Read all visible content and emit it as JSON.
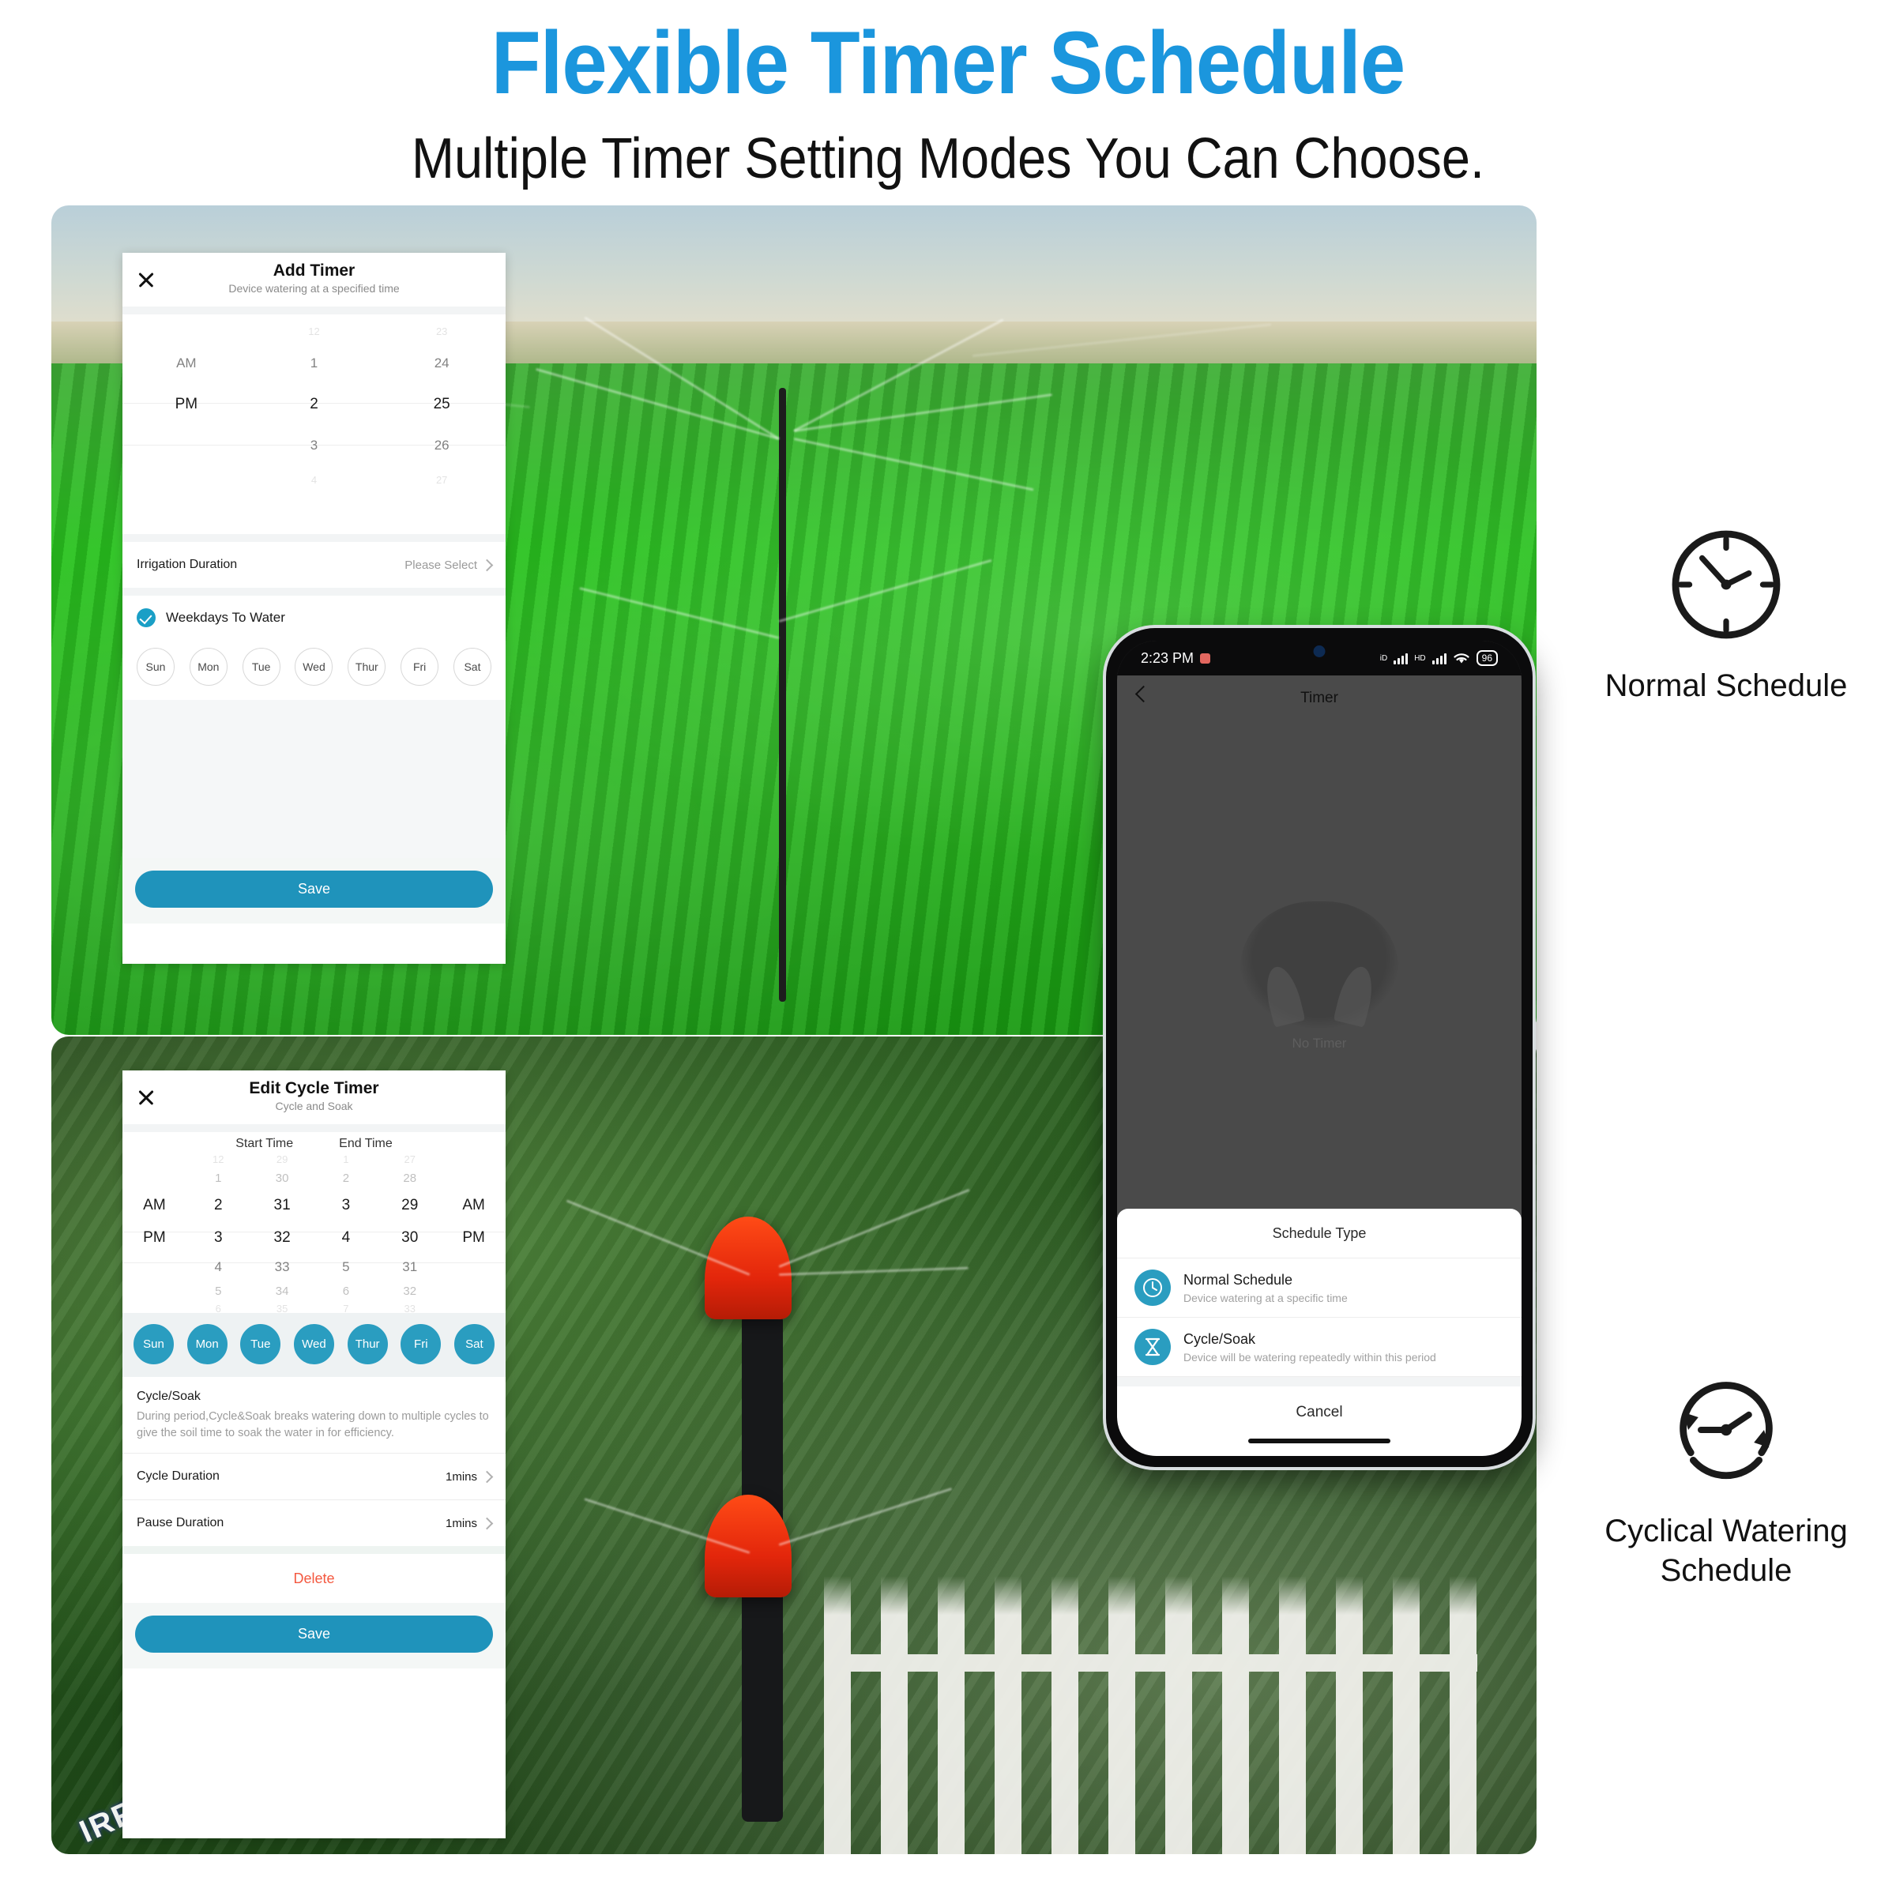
{
  "headline": {
    "title": "Flexible Timer Schedule",
    "subtitle": "Multiple Timer Setting Modes You Can Choose."
  },
  "colors": {
    "headline_blue": "#1b96dd",
    "accent_teal": "#1f93bb",
    "chip_teal": "#2a9dc0",
    "delete_red": "#f4583f"
  },
  "photo_top": {
    "watermark": ""
  },
  "photo_bottom": {
    "watermark": "IRRIGA"
  },
  "add_timer_card": {
    "close_icon": "close-icon",
    "title": "Add Timer",
    "subtitle": "Device watering at a specified time",
    "picker": {
      "meridiem": {
        "above": "",
        "selected": "PM",
        "above1": "AM",
        "below1": ""
      },
      "hours": {
        "above2": "12",
        "above1": "1",
        "selected": "2",
        "below1": "3",
        "below2": "4"
      },
      "minutes": {
        "above2": "23",
        "above1": "24",
        "selected": "25",
        "below1": "26",
        "below2": "27"
      }
    },
    "duration_row": {
      "label": "Irrigation Duration",
      "value": "Please Select",
      "chevron": "chevron-right-icon"
    },
    "weekdays_checkbox": {
      "label": "Weekdays To Water",
      "checked": true,
      "icon": "check-circle-icon"
    },
    "days": [
      "Sun",
      "Mon",
      "Tue",
      "Wed",
      "Thur",
      "Fri",
      "Sat"
    ],
    "save_label": "Save"
  },
  "cycle_timer_card": {
    "close_icon": "close-icon",
    "title": "Edit Cycle Timer",
    "subtitle": "Cycle and Soak",
    "column_headers": {
      "start": "Start Time",
      "end": "End Time"
    },
    "start_picker": {
      "meridiem": {
        "selected": "PM",
        "above1": "AM"
      },
      "hours": {
        "above2": "12",
        "above1": "1",
        "selected": "2",
        "sel2": "3",
        "below1": "4",
        "below2": "5",
        "below3": "6"
      },
      "minutes": {
        "above2": "29",
        "above1": "30",
        "selected": "31",
        "sel2": "32",
        "below1": "33",
        "below2": "34",
        "below3": "35"
      }
    },
    "end_picker": {
      "meridiem": {
        "selected": "PM",
        "above1": "AM"
      },
      "hours": {
        "above2": "1",
        "above1": "2",
        "selected": "3",
        "sel2": "4",
        "below1": "5",
        "below2": "6",
        "below3": "7"
      },
      "minutes": {
        "above2": "27",
        "above1": "28",
        "selected": "29",
        "sel2": "30",
        "below1": "31",
        "below2": "32",
        "below3": "33"
      }
    },
    "days": [
      "Sun",
      "Mon",
      "Tue",
      "Wed",
      "Thur",
      "Fri",
      "Sat"
    ],
    "section": {
      "title": "Cycle/Soak",
      "body": "During period,Cycle&Soak breaks watering down to multiple cycles to give the soil time to soak the water in for efficiency."
    },
    "cycle_duration": {
      "label": "Cycle Duration",
      "value": "1mins",
      "chevron": "chevron-right-icon"
    },
    "pause_duration": {
      "label": "Pause  Duration",
      "value": "1mins",
      "chevron": "chevron-right-icon"
    },
    "delete_label": "Delete",
    "save_label": "Save"
  },
  "phone": {
    "status_bar": {
      "time": "2:23 PM",
      "alarm_icon": "alarm-icon",
      "signal_icon_1": "signal-bars-icon",
      "signal_label_1": "iD",
      "signal_icon_2": "signal-bars-icon",
      "signal_label_2": "HD",
      "wifi_icon": "wifi-icon",
      "battery": "96"
    },
    "nav": {
      "back_icon": "back-chevron-icon",
      "title": "Timer"
    },
    "empty_state": {
      "illustration": "no-timer-illustration",
      "text": "No Timer"
    },
    "sheet": {
      "title": "Schedule Type",
      "options": [
        {
          "icon": "clock-icon",
          "title": "Normal Schedule",
          "subtitle": "Device watering  at a specific time"
        },
        {
          "icon": "hourglass-icon",
          "title": "Cycle/Soak",
          "subtitle": "Device will be watering repeatedly within this period"
        }
      ],
      "cancel_label": "Cancel"
    }
  },
  "legend": {
    "normal": {
      "icon": "clock-outline-icon",
      "label": "Normal Schedule"
    },
    "cyclical": {
      "icon": "cyclical-clock-icon",
      "label": "Cyclical Watering\nSchedule"
    },
    "cyclical_line1": "Cyclical Watering",
    "cyclical_line2": "Schedule"
  }
}
